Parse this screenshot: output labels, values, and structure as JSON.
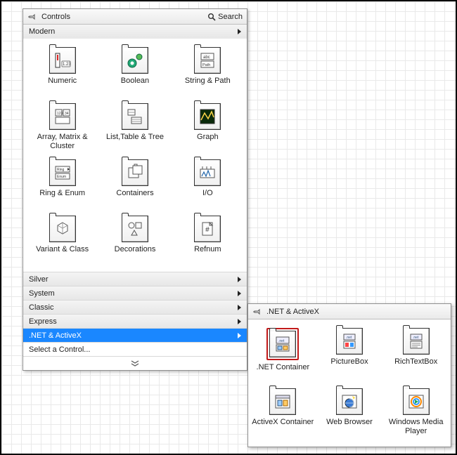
{
  "palette": {
    "title": "Controls",
    "search_label": "Search",
    "expanded_category": "Modern",
    "items": [
      {
        "label": "Numeric"
      },
      {
        "label": "Boolean"
      },
      {
        "label": "String & Path"
      },
      {
        "label": "Array, Matrix & Cluster"
      },
      {
        "label": "List,Table & Tree"
      },
      {
        "label": "Graph"
      },
      {
        "label": "Ring & Enum"
      },
      {
        "label": "Containers"
      },
      {
        "label": "I/O"
      },
      {
        "label": "Variant & Class"
      },
      {
        "label": "Decorations"
      },
      {
        "label": "Refnum"
      }
    ],
    "categories": [
      {
        "label": "Silver",
        "selected": false,
        "has_submenu": true
      },
      {
        "label": "System",
        "selected": false,
        "has_submenu": true
      },
      {
        "label": "Classic",
        "selected": false,
        "has_submenu": true
      },
      {
        "label": "Express",
        "selected": false,
        "has_submenu": true
      },
      {
        "label": ".NET & ActiveX",
        "selected": true,
        "has_submenu": true
      },
      {
        "label": "Select a Control...",
        "selected": false,
        "has_submenu": false
      }
    ]
  },
  "flyout": {
    "title": ".NET & ActiveX",
    "items": [
      {
        "label": ".NET Container",
        "highlighted": true
      },
      {
        "label": "PictureBox"
      },
      {
        "label": "RichTextBox"
      },
      {
        "label": "ActiveX Container"
      },
      {
        "label": "Web Browser"
      },
      {
        "label": "Windows Media Player"
      }
    ]
  }
}
